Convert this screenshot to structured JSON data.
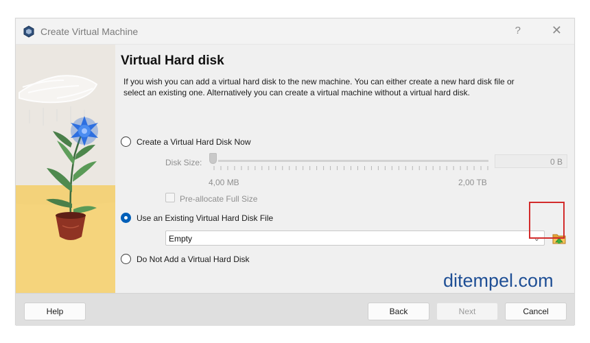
{
  "window": {
    "title": "Create Virtual Machine",
    "help_glyph": "?",
    "close_glyph": "✕"
  },
  "page": {
    "heading": "Virtual Hard disk",
    "description": "If you wish you can add a virtual hard disk to the new machine. You can either create a new hard disk file or select an existing one. Alternatively you can create a virtual machine without a virtual hard disk."
  },
  "options": {
    "create_new": {
      "label": "Create a Virtual Hard Disk Now",
      "selected": false
    },
    "disk_size": {
      "label": "Disk Size:",
      "value": "0 B",
      "min_label": "4,00 MB",
      "max_label": "2,00 TB",
      "fraction": 0.0
    },
    "preallocate": {
      "label": "Pre-allocate Full Size",
      "checked": false
    },
    "use_existing": {
      "label": "Use an Existing Virtual Hard Disk File",
      "selected": true
    },
    "existing_file": {
      "value": "Empty"
    },
    "no_disk": {
      "label": "Do Not Add a Virtual Hard Disk",
      "selected": false
    }
  },
  "watermark": "ditempel.com",
  "buttons": {
    "help": "Help",
    "back": "Back",
    "next": "Next",
    "cancel": "Cancel"
  },
  "icons": {
    "app": "virtualbox-icon",
    "folder": "folder-open-icon"
  },
  "colors": {
    "accent": "#005fb8",
    "highlight": "#d22a2a",
    "watermark": "#1f4f95"
  }
}
